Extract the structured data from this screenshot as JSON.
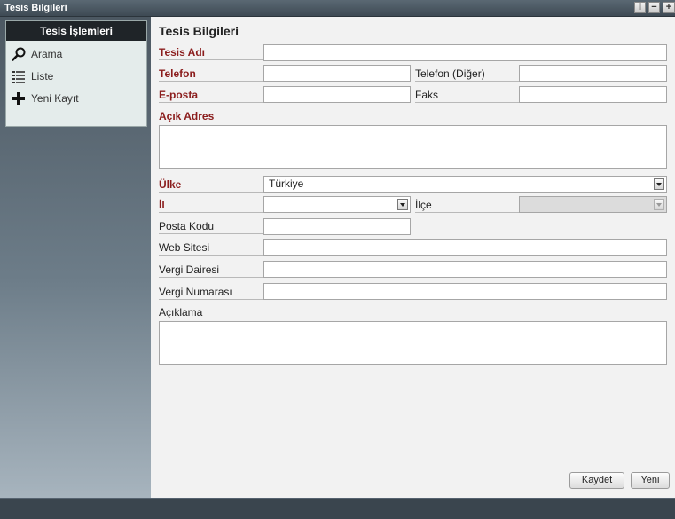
{
  "window": {
    "title": "Tesis Bilgileri"
  },
  "sidebar": {
    "header": "Tesis İşlemleri",
    "items": [
      {
        "label": "Arama",
        "icon": "search-icon"
      },
      {
        "label": "Liste",
        "icon": "list-icon"
      },
      {
        "label": "Yeni Kayıt",
        "icon": "add-icon"
      }
    ]
  },
  "form": {
    "title": "Tesis Bilgileri",
    "tesis_adi": {
      "label": "Tesis Adı",
      "value": ""
    },
    "telefon": {
      "label": "Telefon",
      "value": ""
    },
    "telefon_diger": {
      "label": "Telefon (Diğer)",
      "value": ""
    },
    "eposta": {
      "label": "E-posta",
      "value": ""
    },
    "faks": {
      "label": "Faks",
      "value": ""
    },
    "acik_adres": {
      "label": "Açık Adres",
      "value": ""
    },
    "ulke": {
      "label": "Ülke",
      "value": "Türkiye"
    },
    "il": {
      "label": "İl",
      "value": ""
    },
    "ilce": {
      "label": "İlçe",
      "value": ""
    },
    "posta_kodu": {
      "label": "Posta Kodu",
      "value": ""
    },
    "web_sitesi": {
      "label": "Web Sitesi",
      "value": ""
    },
    "vergi_dairesi": {
      "label": "Vergi Dairesi",
      "value": ""
    },
    "vergi_numarasi": {
      "label": "Vergi Numarası",
      "value": ""
    },
    "aciklama": {
      "label": "Açıklama",
      "value": ""
    }
  },
  "buttons": {
    "save": "Kaydet",
    "new": "Yeni"
  },
  "colors": {
    "required_label": "#8b1d1d",
    "sidebar_header": "#1f2428",
    "panel_bg": "#e4eceb"
  }
}
